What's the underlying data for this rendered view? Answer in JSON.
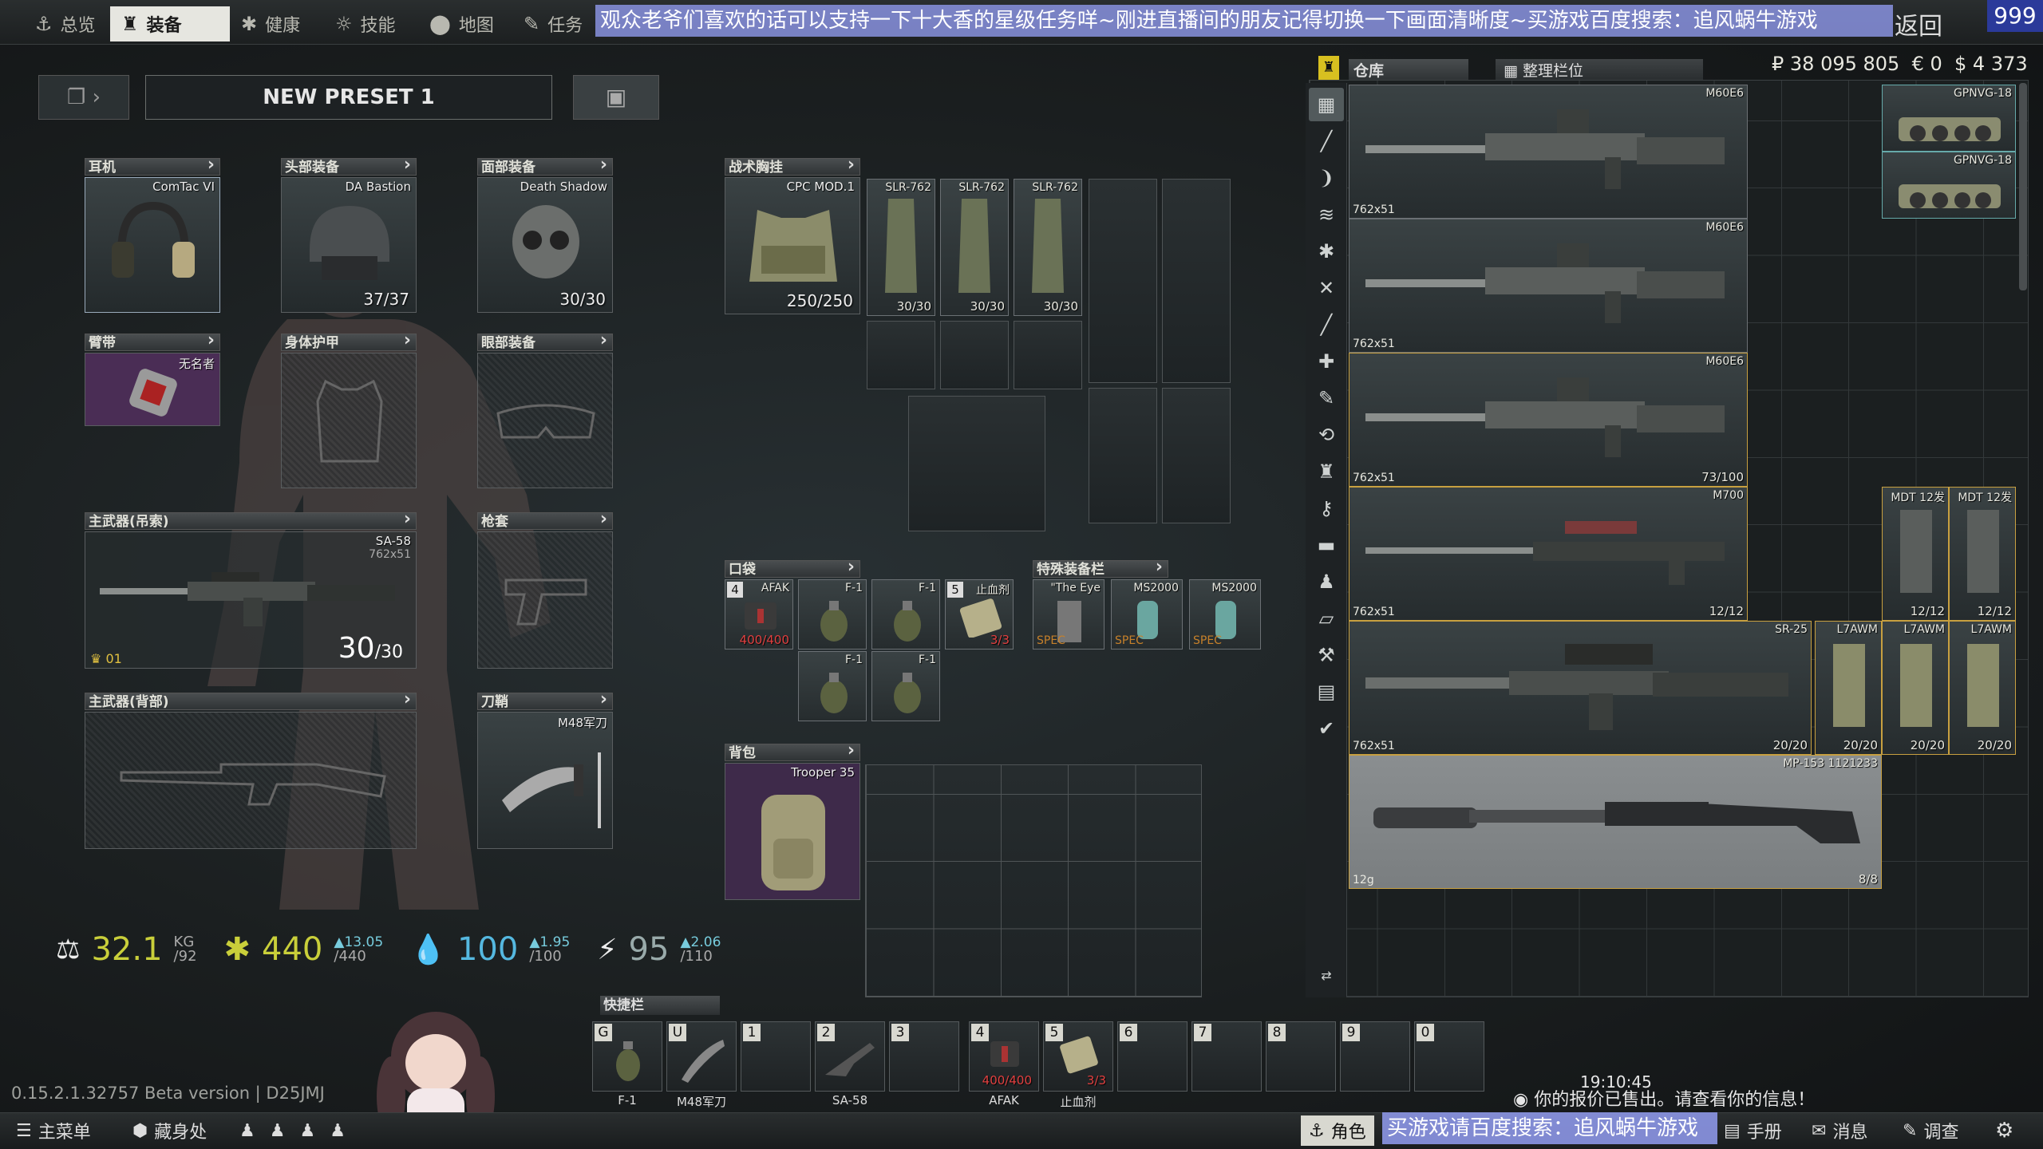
{
  "nav": {
    "tabs": [
      {
        "label": "总览",
        "icon": "anchor-icon"
      },
      {
        "label": "装备",
        "icon": "gear-character-icon"
      },
      {
        "label": "健康",
        "icon": "health-icon"
      },
      {
        "label": "技能",
        "icon": "skills-icon"
      },
      {
        "label": "地图",
        "icon": "map-pin-icon"
      },
      {
        "label": "任务",
        "icon": "tasks-icon"
      }
    ],
    "active_tab": "装备",
    "banner_text": "观众老爷们喜欢的话可以支持一下十大香的星级任务咩~刚进直播间的朋友记得切换一下画面清晰度~买游戏百度搜索：追风蜗牛游戏",
    "back_label": "返回",
    "level": "999"
  },
  "preset": {
    "name": "NEW PRESET 1"
  },
  "slots": {
    "earpiece": {
      "title": "耳机",
      "item": "ComTac VI"
    },
    "headwear": {
      "title": "头部装备",
      "item": "DA Bastion",
      "value": "37/37"
    },
    "facecover": {
      "title": "面部装备",
      "item": "Death Shadow",
      "value": "30/30"
    },
    "armband": {
      "title": "臂带",
      "item": "无名者"
    },
    "body_armor": {
      "title": "身体护甲"
    },
    "eyewear": {
      "title": "眼部装备"
    },
    "primary_sling": {
      "title": "主武器(吊索)",
      "item": "SA-58",
      "caliber": "762x51",
      "ammo": "30",
      "ammo_max": "/30",
      "tag": "01"
    },
    "holster": {
      "title": "枪套"
    },
    "primary_back": {
      "title": "主武器(背部)"
    },
    "scabbard": {
      "title": "刀鞘",
      "item": "M48军刀"
    },
    "rig": {
      "title": "战术胸挂",
      "item": "CPC MOD.1",
      "value": "250/250"
    },
    "pockets": {
      "title": "口袋"
    },
    "special": {
      "title": "特殊装备栏"
    },
    "backpack": {
      "title": "背包",
      "item": "Trooper 35"
    }
  },
  "rig_items": [
    {
      "name": "SLR-762",
      "value": "30/30"
    },
    {
      "name": "SLR-762",
      "value": "30/30"
    },
    {
      "name": "SLR-762",
      "value": "30/30"
    }
  ],
  "pocket_items": [
    {
      "name": "AFAK",
      "count": "4",
      "value": "400/400"
    },
    {
      "name": "F-1"
    },
    {
      "name": "F-1"
    },
    {
      "name": "止血剂",
      "count": "5",
      "value": "3/3"
    },
    {
      "name": "F-1"
    },
    {
      "name": "F-1"
    }
  ],
  "special_items": [
    {
      "name": "\"The Eye",
      "tag": "SPEC"
    },
    {
      "name": "MS2000",
      "tag": "SPEC"
    },
    {
      "name": "MS2000",
      "tag": "SPEC"
    }
  ],
  "stats": {
    "weight": "32.1",
    "weight_unit": "KG",
    "weight_max": "/92",
    "health": "440",
    "health_max": "/440",
    "health_regen": "▲13.05",
    "hydration": "100",
    "hydration_max": "/100",
    "hydration_regen": "▲1.95",
    "energy": "95",
    "energy_max": "/110",
    "energy_regen": "▲2.06"
  },
  "stash": {
    "tab_label": "仓库",
    "sort_label": "整理栏位",
    "money_rub": "₽ 38 095 805",
    "money_eur": "€ 0",
    "money_usd": "$ 4 373",
    "items": [
      {
        "name": "M60E6",
        "caliber": "762x51",
        "value": ""
      },
      {
        "name": "M60E6",
        "caliber": "762x51",
        "value": ""
      },
      {
        "name": "M60E6",
        "caliber": "762x51",
        "value": "73/100"
      },
      {
        "name": "M700",
        "caliber": "762x51",
        "value": "12/12"
      },
      {
        "name": "SR-25",
        "caliber": "762x51",
        "value": "20/20"
      },
      {
        "name": "MP-153 1121233",
        "caliber": "12g",
        "value": "8/8"
      }
    ],
    "side_items": [
      {
        "name": "GPNVG-18"
      },
      {
        "name": "GPNVG-18"
      },
      {
        "name": "MDT 12发",
        "value": "12/12"
      },
      {
        "name": "MDT 12发",
        "value": "12/12"
      },
      {
        "name": "L7AWM",
        "value": "20/20"
      },
      {
        "name": "L7AWM",
        "value": "20/20"
      },
      {
        "name": "L7AWM",
        "value": "20/20"
      }
    ]
  },
  "quickbar": {
    "title": "快捷栏",
    "slots": [
      {
        "key": "G",
        "label": "F-1"
      },
      {
        "key": "U",
        "label": "M48军刀"
      },
      {
        "key": "1",
        "label": ""
      },
      {
        "key": "2",
        "label": "SA-58"
      },
      {
        "key": "3",
        "label": ""
      },
      {
        "key": "4",
        "label": "AFAK",
        "value": "400/400"
      },
      {
        "key": "5",
        "label": "止血剂",
        "value": "3/3"
      },
      {
        "key": "6",
        "label": ""
      },
      {
        "key": "7",
        "label": ""
      },
      {
        "key": "8",
        "label": ""
      },
      {
        "key": "9",
        "label": ""
      },
      {
        "key": "0",
        "label": ""
      }
    ]
  },
  "footer": {
    "version": "0.15.2.1.32757 Beta version | D25JMJ",
    "clock": "19:10:45",
    "notification": "你的报价已售出。请查看你的信息！",
    "main_menu": "主菜单",
    "hideout": "藏身处",
    "character": "角色",
    "banner2": "买游戏请百度搜索：追风蜗牛游戏",
    "handbook": "手册",
    "messages": "消息",
    "survey": "调查"
  },
  "colors": {
    "accent_yellow": "#c9cf3a",
    "hydration_blue": "#55b8e0",
    "banner_purple": "#8c96e6",
    "red_value": "#e04040"
  }
}
